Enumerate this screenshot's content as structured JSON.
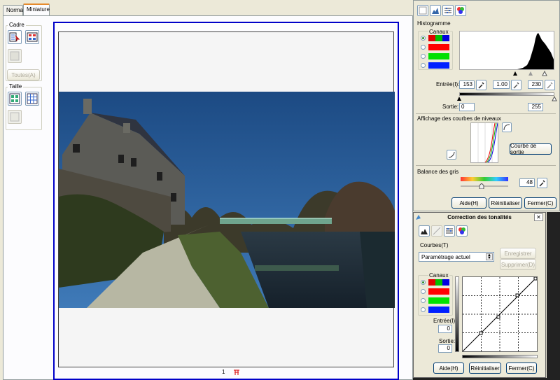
{
  "tabs": [
    {
      "label": "Normal"
    },
    {
      "label": "Miniature"
    }
  ],
  "tools": {
    "frame_group": "Cadre",
    "all_button": "Toutes(A)",
    "size_group": "Taille"
  },
  "preview": {
    "page_number": "1"
  },
  "histogram_panel": {
    "section_title": "Histogramme",
    "channels_label": "Canaux",
    "input_label": "Entrée(I):",
    "input_black": "153",
    "input_gamma": "1.00",
    "input_white": "230",
    "output_label": "Sortie:",
    "output_black": "0",
    "output_white": "255",
    "curves_display_title": "Affichage des courbes de niveaux",
    "output_curve_button": "Courbe de sortie",
    "gray_balance_title": "Balance des gris",
    "gray_balance_value": "48",
    "help_button": "Aide(H)",
    "reset_button": "Réinitialiser",
    "close_button": "Fermer(C)"
  },
  "tone_dialog": {
    "title": "Correction des tonalités",
    "close_glyph": "✕",
    "curves_label": "Courbes(T)",
    "preset_value": "Paramétrage actuel",
    "save_button": "Enregistrer",
    "delete_button": "Supprimer(D)",
    "channels_label": "Canaux",
    "input_label": "Entrée(I):",
    "input_value": "0",
    "output_label": "Sortie:",
    "output_value": "0",
    "help_button": "Aide(H)",
    "reset_button": "Réinitialiser",
    "close_button": "Fermer(C)"
  },
  "colors": {
    "preview_border": "#0000c8",
    "channel_rgb": [
      "#e00000",
      "#00c000",
      "#0000e0"
    ],
    "channel_red": "#ff0000",
    "channel_green": "#00e000",
    "channel_blue": "#0020ff"
  }
}
